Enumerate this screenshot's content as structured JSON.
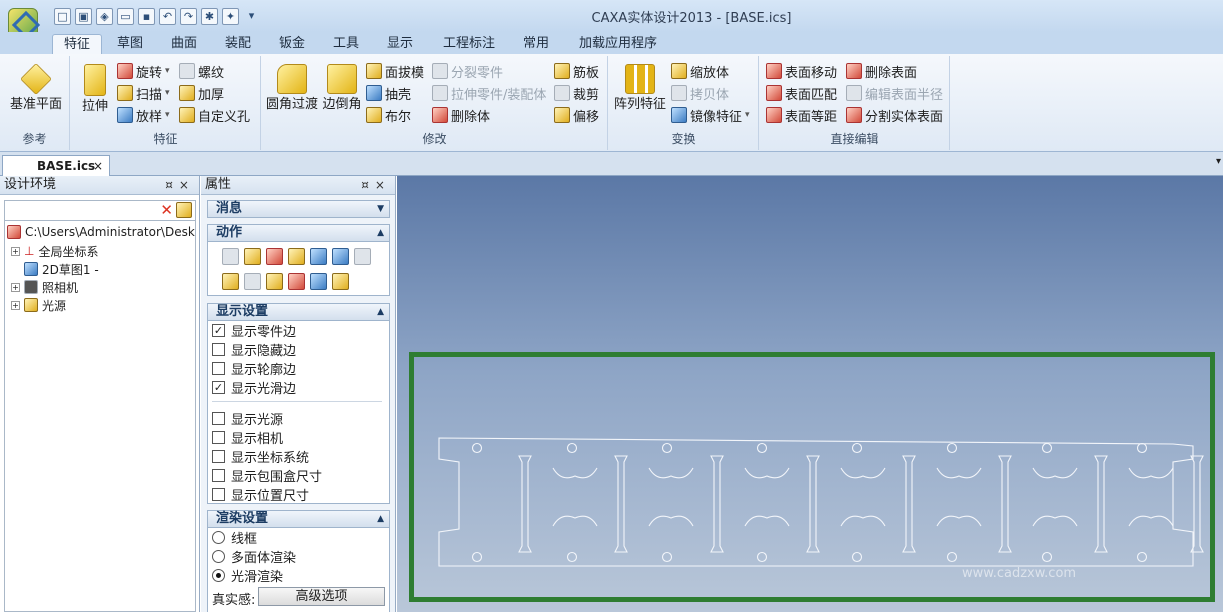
{
  "window": {
    "title": "CAXA实体设计2013 - [BASE.ics]"
  },
  "ribbon_tabs": [
    "特征",
    "草图",
    "曲面",
    "装配",
    "钣金",
    "工具",
    "显示",
    "工程标注",
    "常用",
    "加载应用程序"
  ],
  "active_tab": "特征",
  "groups": {
    "ref": {
      "label": "参考",
      "datum": "基准平面"
    },
    "feature": {
      "label": "特征",
      "extrude": "拉伸",
      "revolve": "旋转",
      "sweep": "扫描",
      "loft": "放样",
      "thread": "螺纹",
      "thicken": "加厚",
      "custom_hole": "自定义孔"
    },
    "modify": {
      "label": "修改",
      "fillet": "圆角过渡",
      "chamfer": "边倒角",
      "draft": "面拔模",
      "shell": "抽壳",
      "boolean": "布尔",
      "split_part": "分裂零件",
      "extrude_part": "拉伸零件/装配体",
      "delete_body": "删除体",
      "rib": "筋板",
      "trim": "裁剪",
      "offset": "偏移"
    },
    "transform": {
      "label": "变换",
      "pattern": "阵列特征",
      "scale": "缩放体",
      "copy": "拷贝体",
      "mirror": "镜像特征"
    },
    "direct": {
      "label": "直接编辑",
      "move_face": "表面移动",
      "match_face": "表面匹配",
      "offset_face": "表面等距",
      "delete_face": "删除表面",
      "edit_radius": "编辑表面半径",
      "split_face": "分割实体表面"
    }
  },
  "doc_tab": "BASE.ics",
  "design_panel": {
    "title": "设计环境",
    "root": "C:\\Users\\Administrator\\Desk",
    "items": [
      "全局坐标系",
      "2D草图1 -",
      "照相机",
      "光源"
    ]
  },
  "prop_panel": {
    "title": "属性",
    "sections": {
      "message": "消息",
      "action": "动作",
      "display": "显示设置",
      "render": "渲染设置"
    },
    "display_options": [
      {
        "label": "显示零件边",
        "checked": true
      },
      {
        "label": "显示隐藏边",
        "checked": false
      },
      {
        "label": "显示轮廓边",
        "checked": false
      },
      {
        "label": "显示光滑边",
        "checked": true
      },
      {
        "label": "显示光源",
        "checked": false
      },
      {
        "label": "显示相机",
        "checked": false
      },
      {
        "label": "显示坐标系统",
        "checked": false
      },
      {
        "label": "显示包围盒尺寸",
        "checked": false
      },
      {
        "label": "显示位置尺寸",
        "checked": false
      }
    ],
    "render_options": [
      {
        "label": "线框",
        "selected": false
      },
      {
        "label": "多面体渲染",
        "selected": false
      },
      {
        "label": "光滑渲染",
        "selected": true
      }
    ],
    "realism_label": "真实感:",
    "advanced_button": "高级选项"
  },
  "colors": {
    "selection_frame": "#2e7d32",
    "viewport_top": "#5b78a6",
    "viewport_bottom": "#b9c7d9"
  },
  "watermark": "www.cadzxw.com"
}
